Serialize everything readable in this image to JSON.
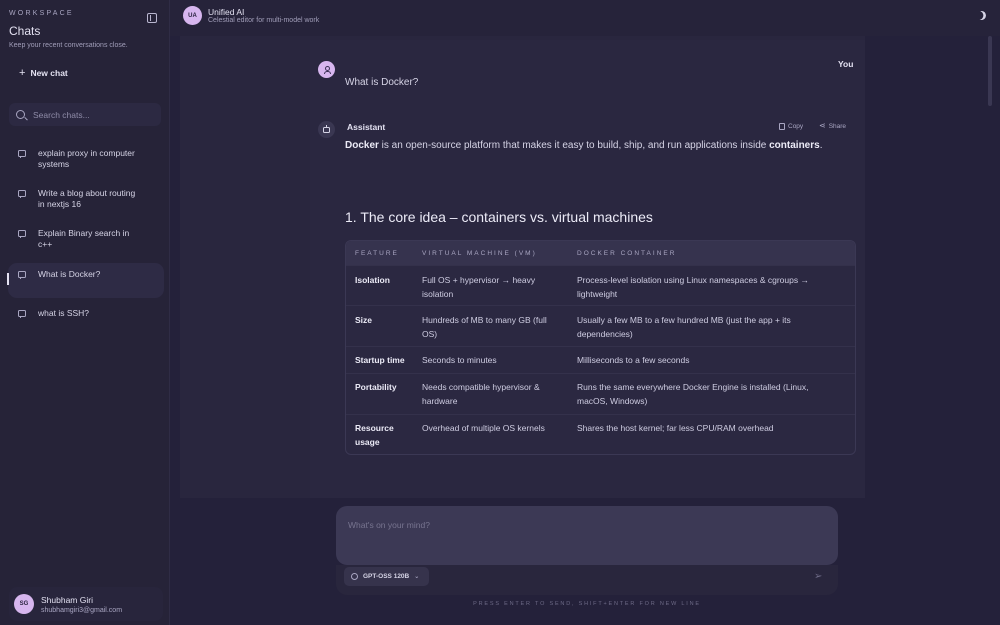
{
  "sidebar": {
    "workspace_label": "WORKSPACE",
    "title": "Chats",
    "subtitle": "Keep your recent conversations close.",
    "new_chat_label": "New chat",
    "search_placeholder": "Search chats...",
    "items": [
      {
        "label": "explain proxy in computer systems"
      },
      {
        "label": "Write a blog about routing in nextjs 16"
      },
      {
        "label": "Explain Binary search in c++"
      },
      {
        "label": "What is Docker?",
        "active": true
      },
      {
        "label": "what is SSH?"
      }
    ],
    "user": {
      "initials": "SG",
      "name": "Shubham Giri",
      "email": "shubhamgiri3@gmail.com"
    }
  },
  "header": {
    "logo_initials": "UA",
    "title": "Unified AI",
    "subtitle": "Celestial editor for multi-model work"
  },
  "conversation": {
    "user_label": "You",
    "user_message": "What is Docker?",
    "assistant_label": "Assistant",
    "copy_label": "Copy",
    "share_label": "Share",
    "intro_bold1": "Docker",
    "intro_mid": " is an open-source platform that makes it easy to build, ship, and run applications inside ",
    "intro_bold2": "containers",
    "intro_end": ".",
    "section_title": "1. The core idea – containers vs. virtual machines",
    "table": {
      "headers": [
        "FEATURE",
        "VIRTUAL MACHINE (VM)",
        "DOCKER CONTAINER"
      ],
      "rows": [
        [
          "Isolation",
          "Full OS + hypervisor → heavy isolation",
          "Process-level isolation using Linux namespaces & cgroups → lightweight"
        ],
        [
          "Size",
          "Hundreds of MB to many GB (full OS)",
          "Usually a few MB to a few hundred MB (just the app + its dependencies)"
        ],
        [
          "Startup time",
          "Seconds to minutes",
          "Milliseconds to a few seconds"
        ],
        [
          "Portability",
          "Needs compatible hypervisor & hardware",
          "Runs the same everywhere Docker Engine is installed (Linux, macOS, Windows)"
        ],
        [
          "Resource usage",
          "Overhead of multiple OS kernels",
          "Shares the host kernel; far less CPU/RAM overhead"
        ]
      ]
    }
  },
  "composer": {
    "placeholder": "What's on your mind?",
    "model_label": "GPT-OSS 120B",
    "hint": "PRESS ENTER TO SEND, SHIFT+ENTER FOR NEW LINE"
  },
  "icons": [
    "sidebar-toggle-icon",
    "plus-icon",
    "search-icon",
    "chat-bubble-icon",
    "moon-icon",
    "user-icon",
    "bot-icon",
    "copy-icon",
    "share-icon",
    "model-icon",
    "chevron-down-icon",
    "send-icon"
  ]
}
